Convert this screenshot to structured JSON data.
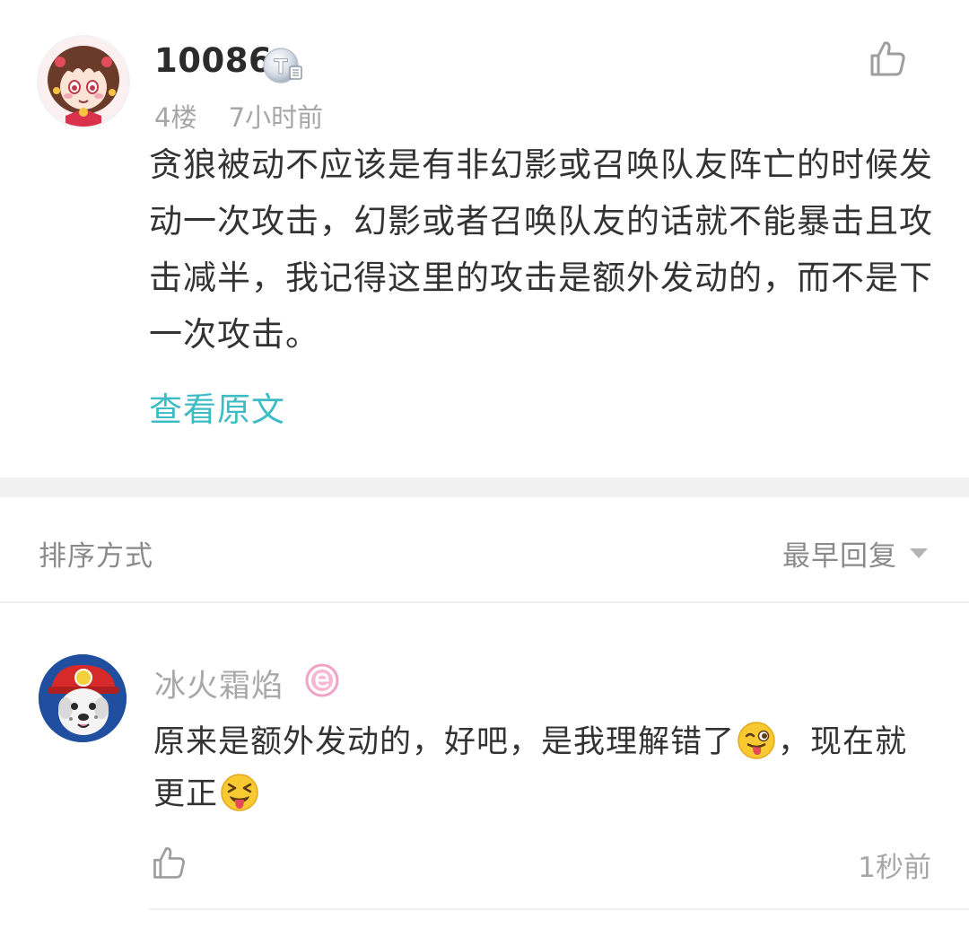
{
  "post": {
    "username": "10086",
    "floor": "4楼",
    "time": "7小时前",
    "content": "贪狼被动不应该是有非幻影或召唤队友阵亡的时候发动一次攻击，幻影或者召唤队友的话就不能暴击且攻击减半，我记得这里的攻击是额外发动的，而不是下一次攻击。",
    "view_original": "查看原文",
    "badge_icon": "t-level-badge-icon",
    "like_icon": "thumbs-up-icon"
  },
  "sort": {
    "label": "排序方式",
    "value": "最早回复"
  },
  "reply": {
    "username": "冰火霜焰",
    "content_part1": "原来是额外发动的，好吧，是我理解错了",
    "content_part2": "，现在就更正",
    "time": "1秒前",
    "emoji_1": "winking-tongue-emoji",
    "emoji_2": "squinting-tongue-emoji",
    "badge_icon": "e-badge-icon",
    "like_icon": "thumbs-up-icon"
  },
  "colors": {
    "link": "#3ebcc6",
    "text": "#333333",
    "muted": "#a6a6a6",
    "separator": "#f1f1f1"
  }
}
